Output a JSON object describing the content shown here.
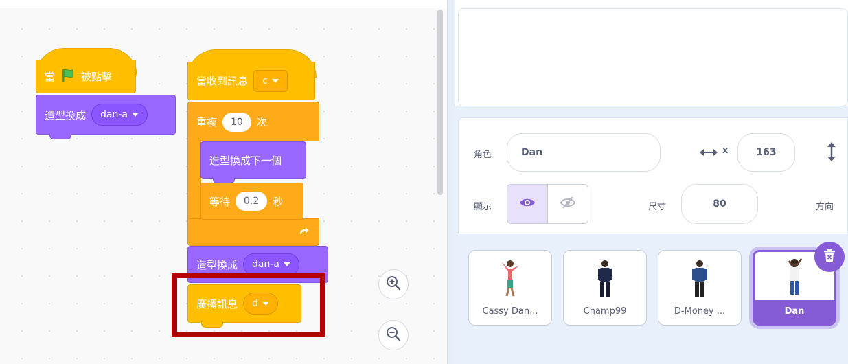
{
  "code_area": {
    "script1": {
      "hat": {
        "prefix": "當",
        "suffix": "被點擊",
        "flag_icon": "green-flag-icon"
      },
      "switch_costume": {
        "label": "造型換成",
        "value": "dan-a"
      }
    },
    "script2": {
      "hat": {
        "label": "當收到訊息",
        "value": "c"
      },
      "repeat": {
        "label": "重複",
        "count": "10",
        "suffix": "次"
      },
      "next_costume": {
        "label": "造型換成下一個"
      },
      "wait": {
        "label": "等待",
        "seconds": "0.2",
        "suffix": "秒"
      },
      "switch_costume": {
        "label": "造型換成",
        "value": "dan-a"
      },
      "broadcast": {
        "label": "廣播訊息",
        "value": "d"
      }
    },
    "zoom": {
      "in_icon": "zoom-in-icon",
      "out_icon": "zoom-out-icon"
    },
    "highlight_color": "#b10000"
  },
  "sprite_info": {
    "sprite_label": "角色",
    "sprite_name": "Dan",
    "x_icon": "horizontal-arrows-icon",
    "x_label": "x",
    "x_value": "163",
    "y_icon": "vertical-arrows-icon",
    "show_label": "顯示",
    "size_label": "尺寸",
    "size_value": "80",
    "direction_label": "方向"
  },
  "sprites": [
    {
      "name": "Cassy Dan...",
      "selected": false
    },
    {
      "name": "Champ99",
      "selected": false
    },
    {
      "name": "D-Money ...",
      "selected": false
    },
    {
      "name": "Dan",
      "selected": true
    }
  ],
  "colors": {
    "events": "#ffbf00",
    "looks": "#9966ff",
    "control": "#ffab19",
    "selected": "#855cd6"
  }
}
